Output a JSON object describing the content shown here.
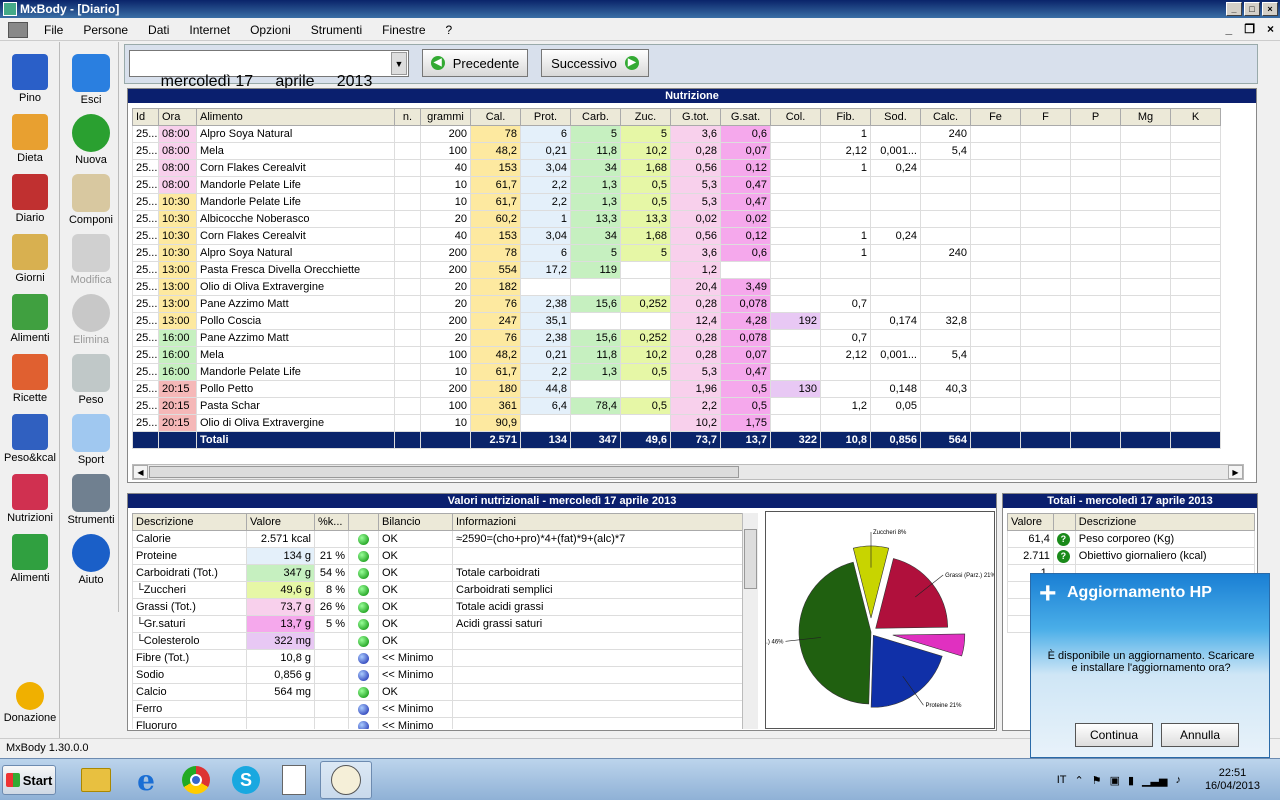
{
  "window": {
    "title": "MxBody - [Diario]"
  },
  "menu": [
    "File",
    "Persone",
    "Dati",
    "Internet",
    "Opzioni",
    "Strumenti",
    "Finestre",
    "?"
  ],
  "left_nav": [
    {
      "label": "Pino",
      "icon": "user-icon"
    },
    {
      "label": "Dieta",
      "icon": "pie-chart-icon"
    },
    {
      "label": "Diario",
      "icon": "calendar-icon"
    },
    {
      "label": "Giorni",
      "icon": "calendar-grid-icon"
    },
    {
      "label": "Alimenti",
      "icon": "vegetables-icon"
    },
    {
      "label": "Ricette",
      "icon": "plate-icon"
    },
    {
      "label": "Peso&kcal",
      "icon": "scale-chart-icon"
    },
    {
      "label": "Nutrizioni",
      "icon": "bar-pie-icon"
    },
    {
      "label": "Alimenti",
      "icon": "food-pyramid-icon"
    },
    {
      "label": "Donazione",
      "icon": "donate-icon"
    }
  ],
  "toolbar": [
    {
      "label": "Esci",
      "icon": "exit-icon",
      "disabled": false
    },
    {
      "label": "Nuova",
      "icon": "add-icon",
      "disabled": false
    },
    {
      "label": "Componi",
      "icon": "compose-icon",
      "disabled": false
    },
    {
      "label": "Modifica",
      "icon": "edit-icon",
      "disabled": true
    },
    {
      "label": "Elimina",
      "icon": "delete-icon",
      "disabled": true
    },
    {
      "label": "Peso",
      "icon": "scale-icon",
      "disabled": false
    },
    {
      "label": "Sport",
      "icon": "sport-icon",
      "disabled": false
    },
    {
      "label": "Strumenti",
      "icon": "tools-icon",
      "disabled": false
    },
    {
      "label": "Aiuto",
      "icon": "help-icon",
      "disabled": false
    }
  ],
  "date": {
    "value": "mercoledì 17     aprile     2013",
    "prev_label": "Precedente",
    "next_label": "Successivo"
  },
  "nutrition": {
    "title": "Nutrizione",
    "columns": [
      "Id",
      "Ora",
      "Alimento",
      "n.",
      "grammi",
      "Cal.",
      "Prot.",
      "Carb.",
      "Zuc.",
      "G.tot.",
      "G.sat.",
      "Col.",
      "Fib.",
      "Sod.",
      "Calc.",
      "Fe",
      "F",
      "P",
      "Mg",
      "K"
    ],
    "rows": [
      [
        "25...",
        "08:00",
        "Alpro Soya Natural",
        "",
        "200",
        "78",
        "6",
        "5",
        "5",
        "3,6",
        "0,6",
        "",
        "1",
        "",
        "240"
      ],
      [
        "25...",
        "08:00",
        "Mela",
        "",
        "100",
        "48,2",
        "0,21",
        "11,8",
        "10,2",
        "0,28",
        "0,07",
        "",
        "2,12",
        "0,001...",
        "5,4"
      ],
      [
        "25...",
        "08:00",
        "Corn Flakes Cerealvit",
        "",
        "40",
        "153",
        "3,04",
        "34",
        "1,68",
        "0,56",
        "0,12",
        "",
        "1",
        "0,24",
        ""
      ],
      [
        "25...",
        "08:00",
        "Mandorle Pelate Life",
        "",
        "10",
        "61,7",
        "2,2",
        "1,3",
        "0,5",
        "5,3",
        "0,47",
        "",
        "",
        "",
        ""
      ],
      [
        "25...",
        "10:30",
        "Mandorle Pelate Life",
        "",
        "10",
        "61,7",
        "2,2",
        "1,3",
        "0,5",
        "5,3",
        "0,47",
        "",
        "",
        "",
        ""
      ],
      [
        "25...",
        "10:30",
        "Albicocche Noberasco",
        "",
        "20",
        "60,2",
        "1",
        "13,3",
        "13,3",
        "0,02",
        "0,02",
        "",
        "",
        "",
        ""
      ],
      [
        "25...",
        "10:30",
        "Corn Flakes Cerealvit",
        "",
        "40",
        "153",
        "3,04",
        "34",
        "1,68",
        "0,56",
        "0,12",
        "",
        "1",
        "0,24",
        ""
      ],
      [
        "25...",
        "10:30",
        "Alpro Soya Natural",
        "",
        "200",
        "78",
        "6",
        "5",
        "5",
        "3,6",
        "0,6",
        "",
        "1",
        "",
        "240"
      ],
      [
        "25...",
        "13:00",
        "Pasta Fresca Divella Orecchiette",
        "",
        "200",
        "554",
        "17,2",
        "119",
        "",
        "1,2",
        "",
        "",
        "",
        "",
        ""
      ],
      [
        "25...",
        "13:00",
        "Olio di Oliva Extravergine",
        "",
        "20",
        "182",
        "",
        "",
        "",
        "20,4",
        "3,49",
        "",
        "",
        "",
        ""
      ],
      [
        "25...",
        "13:00",
        "Pane Azzimo Matt",
        "",
        "20",
        "76",
        "2,38",
        "15,6",
        "0,252",
        "0,28",
        "0,078",
        "",
        "0,7",
        "",
        ""
      ],
      [
        "25...",
        "13:00",
        "Pollo Coscia",
        "",
        "200",
        "247",
        "35,1",
        "",
        "",
        "12,4",
        "4,28",
        "192",
        "",
        "0,174",
        "32,8"
      ],
      [
        "25...",
        "16:00",
        "Pane Azzimo Matt",
        "",
        "20",
        "76",
        "2,38",
        "15,6",
        "0,252",
        "0,28",
        "0,078",
        "",
        "0,7",
        "",
        ""
      ],
      [
        "25...",
        "16:00",
        "Mela",
        "",
        "100",
        "48,2",
        "0,21",
        "11,8",
        "10,2",
        "0,28",
        "0,07",
        "",
        "2,12",
        "0,001...",
        "5,4"
      ],
      [
        "25...",
        "16:00",
        "Mandorle Pelate Life",
        "",
        "10",
        "61,7",
        "2,2",
        "1,3",
        "0,5",
        "5,3",
        "0,47",
        "",
        "",
        "",
        ""
      ],
      [
        "25...",
        "20:15",
        "Pollo Petto",
        "",
        "200",
        "180",
        "44,8",
        "",
        "",
        "1,96",
        "0,5",
        "130",
        "",
        "0,148",
        "40,3"
      ],
      [
        "25...",
        "20:15",
        "Pasta Schar",
        "",
        "100",
        "361",
        "6,4",
        "78,4",
        "0,5",
        "2,2",
        "0,5",
        "",
        "1,2",
        "0,05",
        ""
      ],
      [
        "25...",
        "20:15",
        "Olio di Oliva Extravergine",
        "",
        "10",
        "90,9",
        "",
        "",
        "",
        "10,2",
        "1,75",
        "",
        "",
        "",
        ""
      ]
    ],
    "totals": [
      "",
      "",
      "Totali",
      "",
      "",
      "2.571",
      "134",
      "347",
      "49,6",
      "73,7",
      "13,7",
      "322",
      "10,8",
      "0,856",
      "564"
    ]
  },
  "values_panel": {
    "title": "Valori nutrizionali - mercoledì 17 aprile 2013",
    "columns": [
      "Descrizione",
      "Valore",
      "%k...",
      "",
      "Bilancio",
      "Informazioni"
    ],
    "rows": [
      {
        "desc": "Calorie",
        "val": "2.571 kcal",
        "pct": "",
        "dot": "g",
        "bil": "OK",
        "info": "≈2590=(cho+pro)*4+(fat)*9+(alc)*7",
        "bg": ""
      },
      {
        "desc": "Proteine",
        "val": "134 g",
        "pct": "21 %",
        "dot": "g",
        "bil": "OK",
        "info": "",
        "bg": "#e4f0fa"
      },
      {
        "desc": "Carboidrati (Tot.)",
        "val": "347 g",
        "pct": "54 %",
        "dot": "g",
        "bil": "OK",
        "info": "Totale carboidrati",
        "bg": "#c6f0c0"
      },
      {
        "desc": "└Zuccheri",
        "val": "49,6 g",
        "pct": "8 %",
        "dot": "g",
        "bil": "OK",
        "info": "Carboidrati semplici",
        "bg": "#e6f7a6"
      },
      {
        "desc": "Grassi (Tot.)",
        "val": "73,7 g",
        "pct": "26 %",
        "dot": "g",
        "bil": "OK",
        "info": "Totale acidi grassi",
        "bg": "#f8d0ec"
      },
      {
        "desc": "└Gr.saturi",
        "val": "13,7 g",
        "pct": "5 %",
        "dot": "g",
        "bil": "OK",
        "info": "Acidi grassi saturi",
        "bg": "#f5a8ec"
      },
      {
        "desc": "└Colesterolo",
        "val": "322 mg",
        "pct": "",
        "dot": "g",
        "bil": "OK",
        "info": "",
        "bg": "#e8c8f4"
      },
      {
        "desc": "Fibre (Tot.)",
        "val": "10,8 g",
        "pct": "",
        "dot": "b",
        "bil": "<< Minimo",
        "info": "",
        "bg": ""
      },
      {
        "desc": "Sodio",
        "val": "0,856 g",
        "pct": "",
        "dot": "b",
        "bil": "<< Minimo",
        "info": "",
        "bg": ""
      },
      {
        "desc": "Calcio",
        "val": "564 mg",
        "pct": "",
        "dot": "g",
        "bil": "OK",
        "info": "",
        "bg": ""
      },
      {
        "desc": "Ferro",
        "val": "",
        "pct": "",
        "dot": "b",
        "bil": "<< Minimo",
        "info": "",
        "bg": ""
      },
      {
        "desc": "Fluoruro",
        "val": "",
        "pct": "",
        "dot": "b",
        "bil": "<< Minimo",
        "info": "",
        "bg": ""
      }
    ]
  },
  "chart_data": {
    "type": "pie",
    "slices": [
      {
        "label": "Zuccheri 8%",
        "value": 8,
        "color": "#c8d400"
      },
      {
        "label": "Grassi (Parz.) 21%",
        "value": 21,
        "color": "#b0103c"
      },
      {
        "label": "",
        "value": 5,
        "color": "#e030c0"
      },
      {
        "label": "Proteine 21%",
        "value": 21,
        "color": "#1030a8"
      },
      {
        "label": "Carboidrati (Parz.) 46%",
        "value": 46,
        "color": "#206010"
      }
    ]
  },
  "totals_panel": {
    "title": "Totali - mercoledì 17 aprile 2013",
    "columns": [
      "Valore",
      "",
      "Descrizione"
    ],
    "rows": [
      {
        "val": "61,4",
        "desc": "Peso corporeo (Kg)"
      },
      {
        "val": "2.711",
        "desc": "Obiettivo giornaliero (kcal)"
      },
      {
        "val": "1.",
        "desc": ""
      },
      {
        "val": "2.",
        "desc": ""
      },
      {
        "val": "2.",
        "desc": ""
      },
      {
        "val": "2.",
        "desc": ""
      }
    ]
  },
  "status": "MxBody 1.30.0.0",
  "taskbar": {
    "start": "Start",
    "lang": "IT",
    "time": "22:51",
    "date": "16/04/2013"
  },
  "popup": {
    "title": "Aggiornamento HP",
    "message": "È disponibile un aggiornamento. Scaricare e installare l'aggiornamento ora?",
    "ok": "Continua",
    "cancel": "Annulla"
  },
  "colors": {
    "cal": "#fde9a0",
    "prot": "#e4f0fa",
    "carb": "#c6f0c0",
    "zuc": "#e6f7a6",
    "gtot": "#f8d0ec",
    "gsat": "#f5a8ec",
    "col": "#e8c8f4",
    "ora_morning": "#f8d0ec",
    "ora_midday": "#fde9a0",
    "ora_afternoon": "#c6f0c0",
    "ora_evening": "#f5b8b8"
  }
}
